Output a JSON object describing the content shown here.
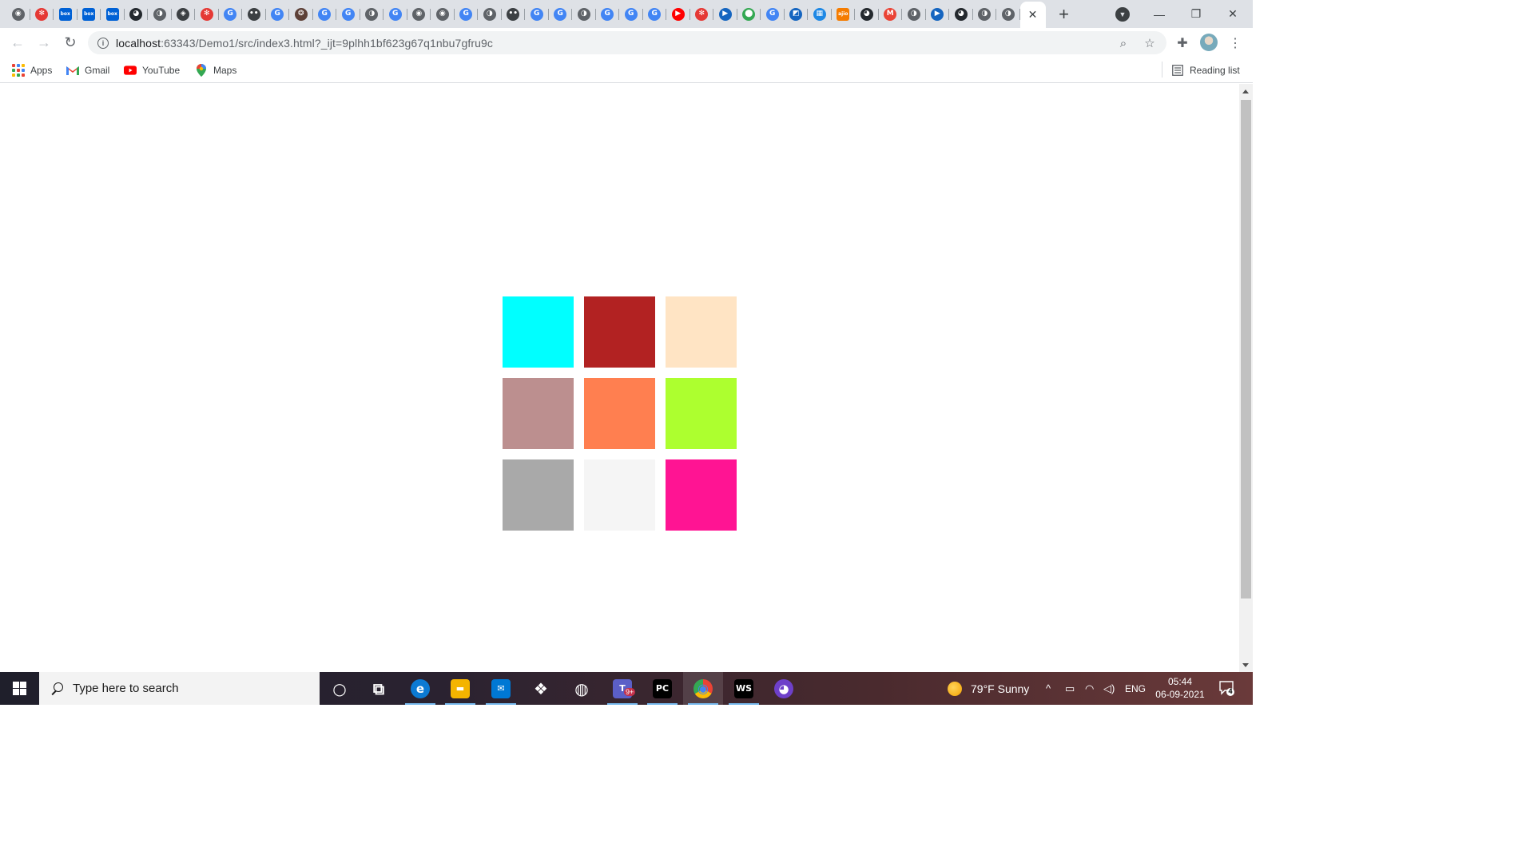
{
  "browser": {
    "tabs": [
      {
        "icon": "chrome-icon",
        "color": "#5f6368",
        "glyph": "◉"
      },
      {
        "icon": "angular-icon",
        "color": "#e53935",
        "glyph": "✻"
      },
      {
        "icon": "box-icon",
        "color": "#0061d5",
        "glyph": "box"
      },
      {
        "icon": "box-icon",
        "color": "#0061d5",
        "glyph": "box"
      },
      {
        "icon": "box-icon",
        "color": "#0061d5",
        "glyph": "box"
      },
      {
        "icon": "github-icon",
        "color": "#24292e",
        "glyph": "◕"
      },
      {
        "icon": "globe-icon",
        "color": "#5f6368",
        "glyph": "◑"
      },
      {
        "icon": "diamond-icon",
        "color": "#3c4043",
        "glyph": "◈"
      },
      {
        "icon": "angular-icon",
        "color": "#e53935",
        "glyph": "✻"
      },
      {
        "icon": "google-icon",
        "color": "#4285f4",
        "glyph": "G"
      },
      {
        "icon": "dots-icon",
        "color": "#3c4043",
        "glyph": "••"
      },
      {
        "icon": "google-icon",
        "color": "#4285f4",
        "glyph": "G"
      },
      {
        "icon": "badge-icon",
        "color": "#5d4037",
        "glyph": "❂"
      },
      {
        "icon": "google-icon",
        "color": "#4285f4",
        "glyph": "G"
      },
      {
        "icon": "google-icon",
        "color": "#4285f4",
        "glyph": "G"
      },
      {
        "icon": "globe-icon",
        "color": "#5f6368",
        "glyph": "◑"
      },
      {
        "icon": "google-icon",
        "color": "#4285f4",
        "glyph": "G"
      },
      {
        "icon": "chrome-icon",
        "color": "#5f6368",
        "glyph": "◉"
      },
      {
        "icon": "chrome-icon",
        "color": "#5f6368",
        "glyph": "◉"
      },
      {
        "icon": "google-icon",
        "color": "#4285f4",
        "glyph": "G"
      },
      {
        "icon": "globe-icon",
        "color": "#5f6368",
        "glyph": "◑"
      },
      {
        "icon": "dots-icon",
        "color": "#3c4043",
        "glyph": "••"
      },
      {
        "icon": "google-icon",
        "color": "#4285f4",
        "glyph": "G"
      },
      {
        "icon": "google-icon",
        "color": "#4285f4",
        "glyph": "G"
      },
      {
        "icon": "globe-icon",
        "color": "#5f6368",
        "glyph": "◑"
      },
      {
        "icon": "google-icon",
        "color": "#4285f4",
        "glyph": "G"
      },
      {
        "icon": "google-icon",
        "color": "#4285f4",
        "glyph": "G"
      },
      {
        "icon": "google-icon",
        "color": "#4285f4",
        "glyph": "G"
      },
      {
        "icon": "youtube-icon",
        "color": "#ff0000",
        "glyph": "▶"
      },
      {
        "icon": "angular-icon",
        "color": "#e53935",
        "glyph": "✻"
      },
      {
        "icon": "play-icon",
        "color": "#1565c0",
        "glyph": "▶"
      },
      {
        "icon": "maps-icon",
        "color": "#34a853",
        "glyph": "⬤"
      },
      {
        "icon": "google-icon",
        "color": "#4285f4",
        "glyph": "G"
      },
      {
        "icon": "chart-icon",
        "color": "#1565c0",
        "glyph": "◩"
      },
      {
        "icon": "grid-icon",
        "color": "#1e88e5",
        "glyph": "▦"
      },
      {
        "icon": "ajio-icon",
        "color": "#f57c00",
        "glyph": "ajio"
      },
      {
        "icon": "github-icon",
        "color": "#24292e",
        "glyph": "◕"
      },
      {
        "icon": "gmail-icon",
        "color": "#ea4335",
        "glyph": "M"
      },
      {
        "icon": "globe-icon",
        "color": "#5f6368",
        "glyph": "◑"
      },
      {
        "icon": "play-icon",
        "color": "#1565c0",
        "glyph": "▶"
      },
      {
        "icon": "github-icon",
        "color": "#24292e",
        "glyph": "◕"
      },
      {
        "icon": "globe-icon",
        "color": "#5f6368",
        "glyph": "◑"
      },
      {
        "icon": "globe-icon",
        "color": "#5f6368",
        "glyph": "◑"
      }
    ],
    "active_tab_close": "✕",
    "new_tab": "+",
    "url_host": "localhost",
    "url_rest": ":63343/Demo1/src/index3.html?_ijt=9plhh1bf623g67q1nbu7gfru9c",
    "bookmarks": [
      {
        "label": "Apps",
        "icon": "apps-grid-icon"
      },
      {
        "label": "Gmail",
        "icon": "gmail-icon"
      },
      {
        "label": "YouTube",
        "icon": "youtube-icon"
      },
      {
        "label": "Maps",
        "icon": "maps-pin-icon"
      }
    ],
    "reading_list": "Reading list"
  },
  "page": {
    "squares": [
      {
        "name": "square-cyan",
        "color": "#00ffff"
      },
      {
        "name": "square-firebrick",
        "color": "#b22222"
      },
      {
        "name": "square-bisque",
        "color": "#ffe4c4"
      },
      {
        "name": "square-rosybrown",
        "color": "#bc8f8f"
      },
      {
        "name": "square-coral",
        "color": "#ff7f50"
      },
      {
        "name": "square-greenyellow",
        "color": "#adff2f"
      },
      {
        "name": "square-darkgray",
        "color": "#a9a9a9"
      },
      {
        "name": "square-whitesmoke",
        "color": "#f5f5f5"
      },
      {
        "name": "square-deeppink",
        "color": "#ff1493"
      }
    ]
  },
  "taskbar": {
    "search_placeholder": "Type here to search",
    "apps": [
      {
        "name": "cortana",
        "icon": "cortana-icon",
        "glyph": "○",
        "bg": "transparent"
      },
      {
        "name": "task-view",
        "icon": "task-view-icon",
        "glyph": "⧉",
        "bg": "transparent"
      },
      {
        "name": "edge",
        "icon": "edge-icon",
        "glyph": "e",
        "bg": "#0c7ad3"
      },
      {
        "name": "file-explorer",
        "icon": "folder-icon",
        "glyph": "▬",
        "bg": "#f4b400"
      },
      {
        "name": "mail",
        "icon": "mail-icon",
        "glyph": "✉",
        "bg": "#0078d4"
      },
      {
        "name": "dropbox",
        "icon": "dropbox-icon",
        "glyph": "❖",
        "bg": "transparent"
      },
      {
        "name": "sync-app",
        "icon": "circle-app-icon",
        "glyph": "◍",
        "bg": "transparent"
      },
      {
        "name": "teams",
        "icon": "teams-icon",
        "glyph": "T",
        "bg": "#5b5fc7"
      },
      {
        "name": "pycharm",
        "icon": "pycharm-icon",
        "glyph": "PC",
        "bg": "#000000"
      },
      {
        "name": "chrome",
        "icon": "chrome-icon",
        "glyph": "◉",
        "bg": "transparent"
      },
      {
        "name": "webstorm",
        "icon": "webstorm-icon",
        "glyph": "WS",
        "bg": "#000000"
      },
      {
        "name": "github-desktop",
        "icon": "github-desktop-icon",
        "glyph": "◕",
        "bg": "#6e40c9"
      }
    ],
    "teams_badge": "9+",
    "weather": "79°F  Sunny",
    "language": "ENG",
    "time": "05:44",
    "date": "06-09-2021",
    "notification_count": "4"
  }
}
